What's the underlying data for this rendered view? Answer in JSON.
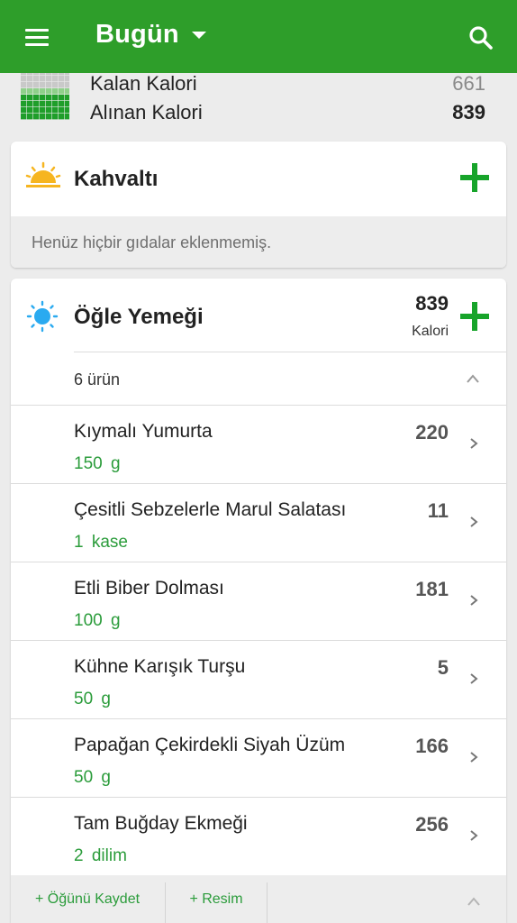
{
  "header": {
    "title": "Bugün",
    "menu_icon": "menu-icon",
    "dropdown_icon": "caret-down-icon",
    "search_icon": "search-icon",
    "bar_color": "#2e9e2a"
  },
  "summary": {
    "remaining_label": "Kalan Kalori",
    "remaining_value": "661",
    "consumed_label": "Alınan Kalori",
    "consumed_value": "839",
    "icon": "calorie-grid-icon"
  },
  "breakfast": {
    "title": "Kahvaltı",
    "icon": "sunrise-icon",
    "empty_message": "Henüz hiçbir gıdalar eklenmemiş."
  },
  "lunch": {
    "title": "Öğle Yemeği",
    "icon": "sun-icon",
    "calories": "839",
    "calories_label": "Kalori",
    "item_count": "6 ürün",
    "items": [
      {
        "name": "Kıymalı Yumurta",
        "amount": "150 g",
        "calories": "220"
      },
      {
        "name": "Çesitli Sebzelerle Marul Salatası",
        "amount": "1 kase",
        "calories": "11"
      },
      {
        "name": "Etli Biber Dolması",
        "amount": "100 g",
        "calories": "181"
      },
      {
        "name": "Kühne Karışık Turşu",
        "amount": "50 g",
        "calories": "5"
      },
      {
        "name": "Papağan Çekirdekli Siyah Üzüm",
        "amount": "50 g",
        "calories": "166"
      },
      {
        "name": "Tam Buğday Ekmeği",
        "amount": "2 dilim",
        "calories": "256"
      }
    ],
    "save_meal": "+ Öğünü Kaydet",
    "add_photo": "+ Resim"
  },
  "colors": {
    "accent": "#17a42a",
    "amount_green": "#2b9c3b"
  }
}
